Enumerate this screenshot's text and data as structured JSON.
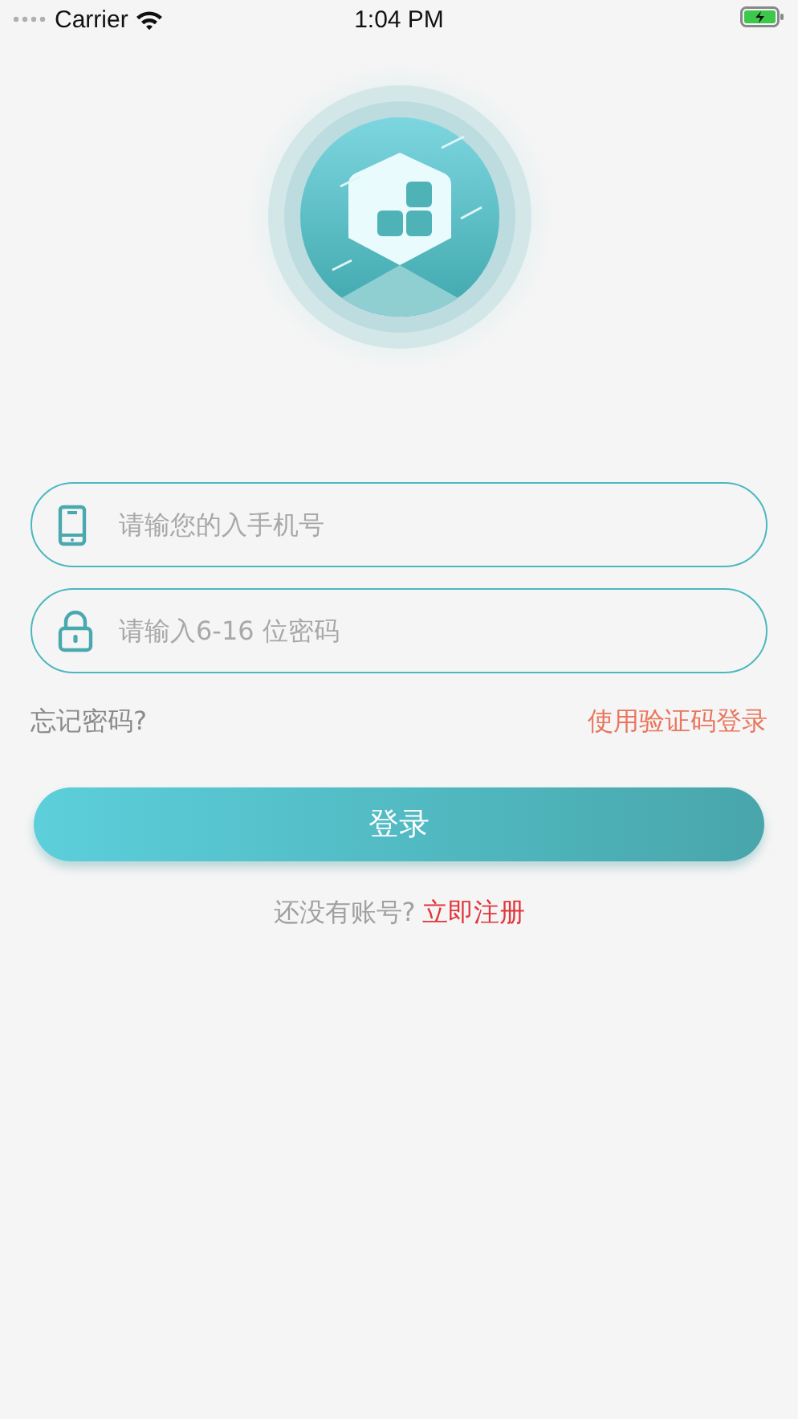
{
  "status_bar": {
    "carrier": "Carrier",
    "time": "1:04 PM"
  },
  "fields": [
    {
      "kind": "phone",
      "placeholder": "请输您的入手机号"
    },
    {
      "kind": "password",
      "placeholder": "请输入6-16 位密码"
    }
  ],
  "forgot_link": "忘记密码?",
  "code_login_link": "使用验证码登录",
  "login_button": "登录",
  "register": {
    "prompt": "还没有账号?",
    "link": "立即注册"
  }
}
